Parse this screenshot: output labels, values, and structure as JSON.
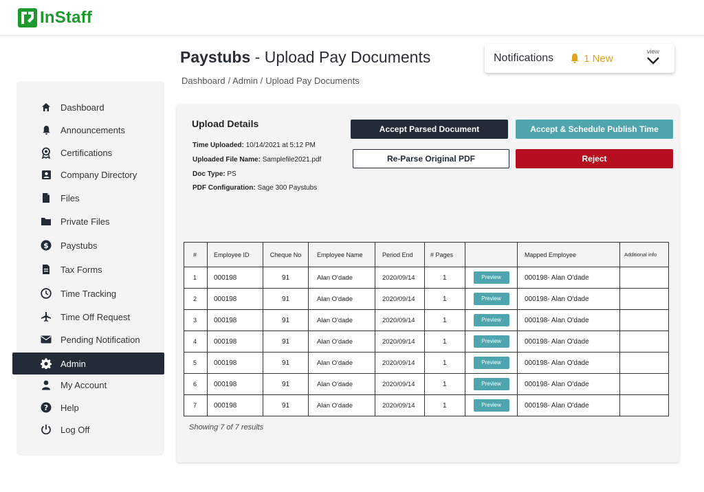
{
  "app": {
    "logo_text": "InStaff",
    "brand_color": "#1c9a2e"
  },
  "header": {
    "title_bold": "Paystubs",
    "title_rest": " - Upload Pay Documents",
    "breadcrumb": [
      "Dashboard",
      "/ Admin /",
      "Upload Pay Documents"
    ]
  },
  "notifications": {
    "label": "Notifications",
    "count_text": "1 New",
    "view_label": "view",
    "icon": "bell-icon"
  },
  "sidebar": {
    "items": [
      {
        "label": "Dashboard",
        "icon": "home-icon"
      },
      {
        "label": "Announcements",
        "icon": "bell-icon"
      },
      {
        "label": "Certifications",
        "icon": "certificate-icon"
      },
      {
        "label": "Company Directory",
        "icon": "contact-card-icon"
      },
      {
        "label": "Files",
        "icon": "file-icon"
      },
      {
        "label": "Private Files",
        "icon": "folder-icon"
      },
      {
        "label": "Paystubs",
        "icon": "dollar-icon"
      },
      {
        "label": "Tax Forms",
        "icon": "document-icon"
      },
      {
        "label": "Time Tracking",
        "icon": "clock-icon"
      },
      {
        "label": "Time Off Request",
        "icon": "airplane-icon"
      },
      {
        "label": "Pending Notification",
        "icon": "mail-icon"
      },
      {
        "label": "Admin",
        "icon": "gear-icon",
        "active": true
      },
      {
        "label": "My Account",
        "icon": "user-icon"
      },
      {
        "label": "Help",
        "icon": "help-icon"
      },
      {
        "label": "Log Off",
        "icon": "power-icon"
      }
    ]
  },
  "upload": {
    "title": "Upload Details",
    "time_label": "Time Uploaded:",
    "time_value": "10/14/2021 at 5:12 PM",
    "file_label": "Uploaded File Name:",
    "file_value": "Samplefile2021.pdf",
    "type_label": "Doc Type:",
    "type_value": "PS",
    "config_label": "PDF Configuration:",
    "config_value": "Sage 300 Paystubs"
  },
  "actions": {
    "accept": "Accept Parsed Document",
    "schedule": "Accept & Schedule Publish Time",
    "reparse": "Re-Parse Original PDF",
    "reject": "Reject"
  },
  "table": {
    "headers": [
      "#",
      "Employee ID",
      "Cheque  No",
      "Employee Name",
      "Period End",
      "# Pages",
      "",
      "Mapped Employee",
      "Additional info"
    ],
    "preview_label": "Preview",
    "rows": [
      {
        "num": "1",
        "emp_id": "000198",
        "cheque": "91",
        "name": "Alan O'dade",
        "period_end": "2020/09/14",
        "pages": "1",
        "mapped": "000198- Alan O'dade",
        "additional": ""
      },
      {
        "num": "2",
        "emp_id": "000198",
        "cheque": "91",
        "name": "Alan O'dade",
        "period_end": "2020/09/14",
        "pages": "1",
        "mapped": "000198- Alan O'dade",
        "additional": ""
      },
      {
        "num": "3",
        "emp_id": "000198",
        "cheque": "91",
        "name": "Alan O'dade",
        "period_end": "2020/09/14",
        "pages": "1",
        "mapped": "000198- Alan O'dade",
        "additional": ""
      },
      {
        "num": "4",
        "emp_id": "000198",
        "cheque": "91",
        "name": "Alan O'dade",
        "period_end": "2020/09/14",
        "pages": "1",
        "mapped": "000198- Alan O'dade",
        "additional": ""
      },
      {
        "num": "5",
        "emp_id": "000198",
        "cheque": "91",
        "name": "Alan O'dade",
        "period_end": "2020/09/14",
        "pages": "1",
        "mapped": "000198- Alan O'dade",
        "additional": ""
      },
      {
        "num": "6",
        "emp_id": "000198",
        "cheque": "91",
        "name": "Alan O'dade",
        "period_end": "2020/09/14",
        "pages": "1",
        "mapped": "000198- Alan O'dade",
        "additional": ""
      },
      {
        "num": "7",
        "emp_id": "000198",
        "cheque": "91",
        "name": "Alan O'dade",
        "period_end": "2020/09/14",
        "pages": "1",
        "mapped": "000198- Alan O'dade",
        "additional": ""
      }
    ],
    "results_text": "Showing 7 of 7 results"
  },
  "colors": {
    "dark": "#222b36",
    "teal": "#4fa5ad",
    "red": "#b50f1f",
    "notice": "#e0a21a"
  }
}
